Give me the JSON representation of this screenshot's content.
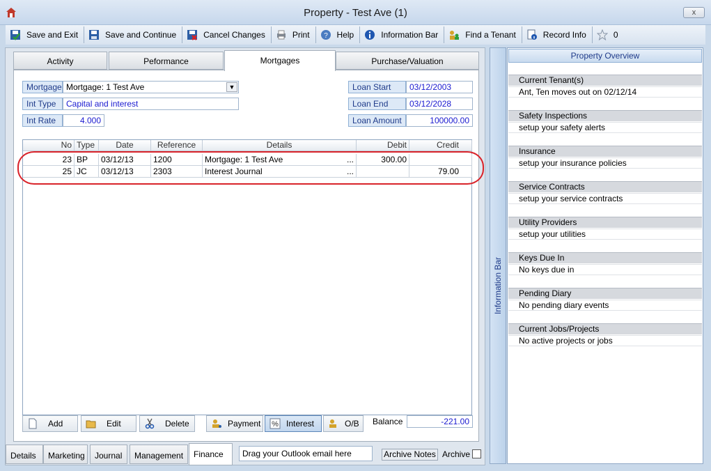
{
  "window": {
    "title": "Property  - Test Ave (1)",
    "close_glyph": "x"
  },
  "toolbar": [
    {
      "label": "Save and Exit",
      "icon": "save-exit-icon"
    },
    {
      "label": "Save and Continue",
      "icon": "save-continue-icon"
    },
    {
      "label": "Cancel Changes",
      "icon": "cancel-changes-icon"
    },
    {
      "label": "Print",
      "icon": "print-icon"
    },
    {
      "label": "Help",
      "icon": "help-icon"
    },
    {
      "label": "Information Bar",
      "icon": "info-icon"
    },
    {
      "label": "Find a Tenant",
      "icon": "find-tenant-icon"
    },
    {
      "label": "Record Info",
      "icon": "record-info-icon"
    },
    {
      "label": "0",
      "icon": "star-icon"
    }
  ],
  "tabs": [
    "Activity",
    "Peformance",
    "Mortgages",
    "Purchase/Valuation"
  ],
  "active_tab": "Mortgages",
  "mortgage": {
    "mortgage_label": "Mortgage",
    "mortgage_value": "Mortgage: 1 Test Ave",
    "int_type_label": "Int Type",
    "int_type_value": "Capital and interest",
    "int_rate_label": "Int Rate",
    "int_rate_value": "4.000",
    "loan_start_label": "Loan Start",
    "loan_start_value": "03/12/2003",
    "loan_end_label": "Loan End",
    "loan_end_value": "03/12/2028",
    "loan_amount_label": "Loan Amount",
    "loan_amount_value": "100000.00"
  },
  "grid": {
    "columns": [
      "No",
      "Type",
      "Date",
      "Reference",
      "Details",
      "Debit",
      "Credit"
    ],
    "rows": [
      {
        "no": "23",
        "type": "BP",
        "date": "03/12/13",
        "reference": "1200",
        "details": "Mortgage: 1 Test Ave",
        "more": "...",
        "debit": "300.00",
        "credit": ""
      },
      {
        "no": "25",
        "type": "JC",
        "date": "03/12/13",
        "reference": "2303",
        "details": "Interest Journal",
        "more": "...",
        "debit": "",
        "credit": "79.00"
      }
    ]
  },
  "buttons": {
    "add": "Add",
    "edit": "Edit",
    "delete": "Delete",
    "payment": "Payment",
    "interest": "Interest",
    "ob": "O/B",
    "balance_label": "Balance",
    "balance_value": "-221.00"
  },
  "bottom_tabs": [
    "Details",
    "Marketing",
    "Journal",
    "Management",
    "Finance"
  ],
  "active_bottom_tab": "Finance",
  "outlook_drop": "Drag your Outlook email here",
  "archive_notes": "Archive Notes",
  "archive_label": "Archive",
  "info_bar": {
    "side_label": "Information Bar",
    "header": "Property Overview",
    "sections": [
      {
        "title": "Current Tenant(s)",
        "value": "Ant, Ten moves out on 02/12/14"
      },
      {
        "title": "Safety Inspections",
        "value": "setup your safety alerts"
      },
      {
        "title": "Insurance",
        "value": "setup your insurance policies"
      },
      {
        "title": "Service Contracts",
        "value": "setup your service contracts"
      },
      {
        "title": "Utility Providers",
        "value": "setup your utilities"
      },
      {
        "title": "Keys Due In",
        "value": "No keys due in"
      },
      {
        "title": "Pending Diary",
        "value": "No pending diary events"
      },
      {
        "title": "Current Jobs/Projects",
        "value": "No active projects or jobs"
      }
    ]
  },
  "colors": {
    "accent": "#1a1ad0",
    "highlight_circle": "#d9232a",
    "label_bg": "#dde9f7"
  }
}
